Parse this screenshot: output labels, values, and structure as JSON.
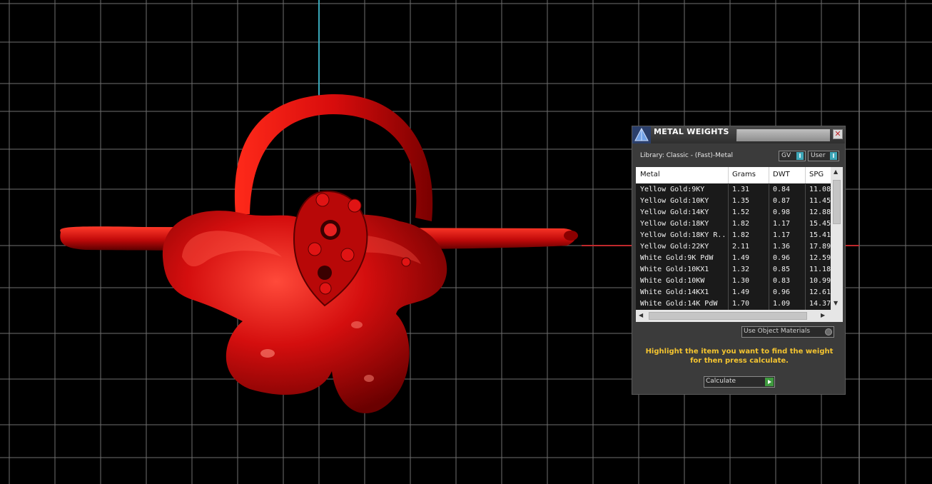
{
  "viewport": {
    "background_color": "#000000",
    "grid_color": "#6f6f6f",
    "axis_vertical_color": "#3aa7b8",
    "axis_horizontal_color": "#c0282c",
    "model": "red ring with flower and teardrop setting"
  },
  "dialog": {
    "title": "METAL WEIGHTS",
    "close_label": "✕",
    "library_label": "Library: Classic - (Fast)-Metal",
    "gv_label": "GV",
    "user_label": "User",
    "toggle_indicator": "I",
    "table": {
      "columns": [
        "Metal",
        "Grams",
        "DWT",
        "SPG"
      ],
      "rows": [
        [
          "Yellow Gold:9KY",
          "1.31",
          "0.84",
          "11.08"
        ],
        [
          "Yellow Gold:10KY",
          "1.35",
          "0.87",
          "11.45"
        ],
        [
          "Yellow Gold:14KY",
          "1.52",
          "0.98",
          "12.88"
        ],
        [
          "Yellow Gold:18KY",
          "1.82",
          "1.17",
          "15.45"
        ],
        [
          "Yellow Gold:18KY R...",
          "1.82",
          "1.17",
          "15.41"
        ],
        [
          "Yellow Gold:22KY",
          "2.11",
          "1.36",
          "17.89"
        ],
        [
          "White Gold:9K PdW",
          "1.49",
          "0.96",
          "12.59"
        ],
        [
          "White Gold:10KX1",
          "1.32",
          "0.85",
          "11.18"
        ],
        [
          "White Gold:10KW",
          "1.30",
          "0.83",
          "10.99"
        ],
        [
          "White Gold:14KX1",
          "1.49",
          "0.96",
          "12.61"
        ],
        [
          "White Gold:14K PdW",
          "1.70",
          "1.09",
          "14.37"
        ]
      ]
    },
    "use_object_materials_label": "Use Object Materials",
    "instructions": "Highlight the item you want to find the weight for then press calculate.",
    "calculate_label": "Calculate"
  }
}
